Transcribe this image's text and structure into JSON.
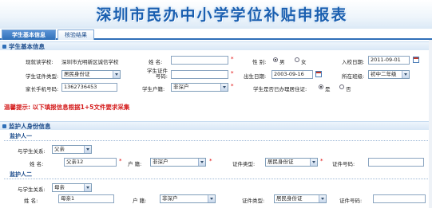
{
  "banner": {
    "title": "深圳市民办中小学学位补贴申报表"
  },
  "tabs": [
    {
      "label": "学生基本信息"
    },
    {
      "label": "核验结果"
    }
  ],
  "student_section": {
    "title": "学生基本信息",
    "school_label": "现就读学校:",
    "school_value": "深圳市光明新区诚信学校",
    "name_label": "姓    名:",
    "name_value": "",
    "gender_label": "性    别:",
    "gender_options": [
      "男",
      "女"
    ],
    "gender_selected": "男",
    "enroll_date_label": "入校日期:",
    "enroll_date_value": "2011-09-01",
    "id_type_label": "学生证件类型:",
    "id_type_value": "居民身份证",
    "id_no_label": "学生证件号码:",
    "id_no_value": "",
    "birth_label": "出生日期:",
    "birth_value": "2003-09-16",
    "grade_label": "所在班级:",
    "grade_value": "初中二年级",
    "phone_label": "家长手机号码:",
    "phone_value": "1362736453",
    "hukou_label": "学生户籍:",
    "hukou_value": "非深户",
    "permit_label": "学生是否已办理居住证:",
    "permit_options": [
      "是",
      "否"
    ],
    "permit_selected": "是"
  },
  "notice": "温馨提示: 以下填报信息根据1+5文件要求采集",
  "guardian_section": {
    "title": "监护人身份信息",
    "guardian1": {
      "heading": "监护人一",
      "relation_label": "与学生关系:",
      "relation_value": "父亲",
      "name_label": "姓    名:",
      "name_value": "父亲12",
      "hukou_label": "户    籍:",
      "hukou_value": "非深户",
      "id_type_label": "证件类型:",
      "id_type_value": "居民身份证",
      "id_no_label": "证件号码:",
      "id_no_value": ""
    },
    "guardian2": {
      "heading": "监护人二",
      "relation_label": "与学生关系:",
      "relation_value": "母亲",
      "name_label": "姓    名:",
      "name_value": "母亲1",
      "hukou_label": "户    籍:",
      "hukou_value": "非深户",
      "id_type_label": "证件类型:",
      "id_type_value": "居民身份证",
      "id_no_label": "证件号码:",
      "id_no_value": ""
    }
  },
  "colors": {
    "accent": "#2f6fb8",
    "notice": "#d41a1a",
    "required": "#e00000"
  }
}
